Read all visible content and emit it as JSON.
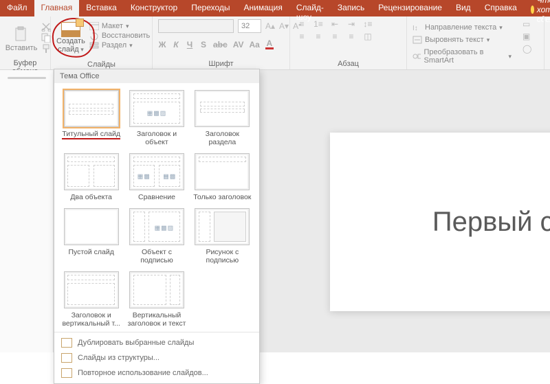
{
  "tabs": {
    "file": "Файл",
    "home": "Главная",
    "insert": "Вставка",
    "design": "Конструктор",
    "transitions": "Переходы",
    "animation": "Анимация",
    "slideshow": "Слайд-шоу",
    "record": "Запись",
    "review": "Рецензирование",
    "view": "Вид",
    "help": "Справка",
    "tell_me": "Что вы хотите сдела"
  },
  "ribbon": {
    "clipboard": {
      "label": "Буфер обмена",
      "paste": "Вставить"
    },
    "slides": {
      "label": "Слайды",
      "new_slide_line1": "Создать",
      "new_slide_line2": "слайд",
      "layout": "Макет",
      "reset": "Восстановить",
      "section": "Раздел"
    },
    "font": {
      "label": "Шрифт",
      "size": "32"
    },
    "paragraph": {
      "label": "Абзац",
      "text_direction": "Направление текста",
      "align_text": "Выровнять текст",
      "smartart": "Преобразовать в SmartArt"
    }
  },
  "gallery": {
    "header": "Тема Office",
    "items": [
      "Титульный слайд",
      "Заголовок и объект",
      "Заголовок раздела",
      "Два объекта",
      "Сравнение",
      "Только заголовок",
      "Пустой слайд",
      "Объект с подписью",
      "Рисунок с подписью",
      "Заголовок и вертикальный т...",
      "Вертикальный заголовок и текст"
    ],
    "footer": {
      "duplicate": "Дублировать выбранные слайды",
      "from_outline": "Слайды из структуры...",
      "reuse": "Повторное использование слайдов..."
    }
  },
  "slide": {
    "title": "Первый сла"
  }
}
